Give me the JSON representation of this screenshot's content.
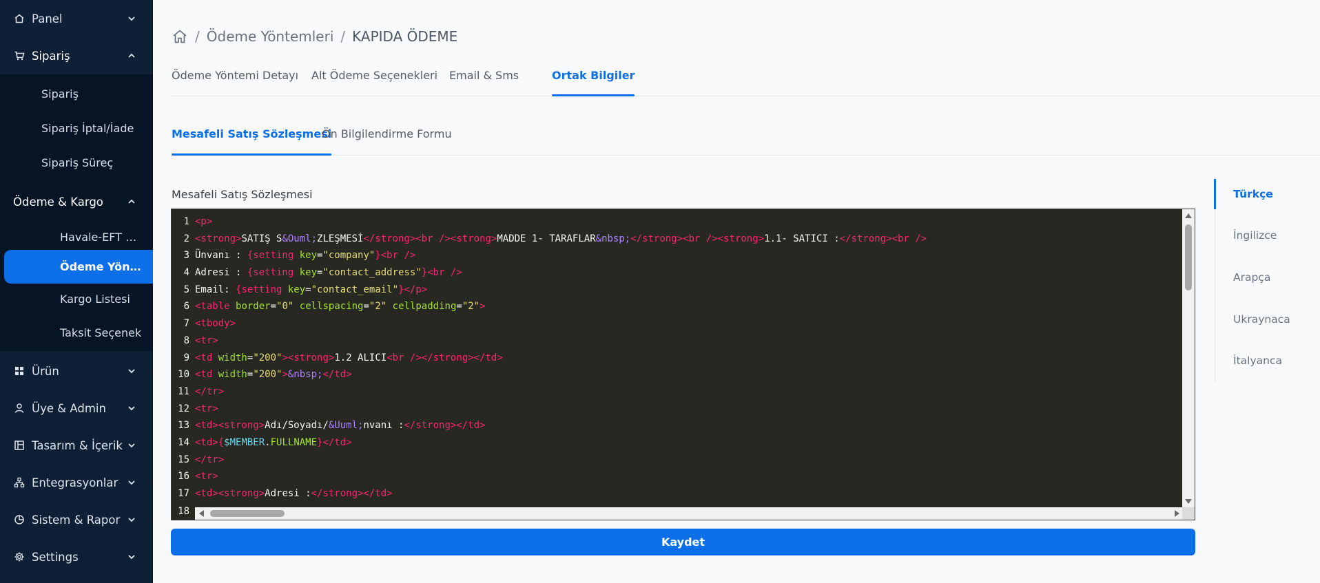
{
  "sidebar": {
    "items": [
      {
        "label": "Panel",
        "icon": "home-icon",
        "expanded": false
      },
      {
        "label": "Sipariş",
        "icon": "cart-icon",
        "expanded": true
      },
      {
        "label": "Ödeme & Kargo",
        "icon": "",
        "expanded": true
      },
      {
        "label": "Ürün",
        "icon": "grid-icon",
        "expanded": false
      },
      {
        "label": "Üye & Admin",
        "icon": "user-icon",
        "expanded": false
      },
      {
        "label": "Tasarım & İçerik",
        "icon": "layout-icon",
        "expanded": false
      },
      {
        "label": "Entegrasyonlar",
        "icon": "sitemap-icon",
        "expanded": false
      },
      {
        "label": "Sistem & Rapor",
        "icon": "pie-chart-icon",
        "expanded": false
      },
      {
        "label": "Settings",
        "icon": "gear-icon",
        "expanded": false
      }
    ],
    "siparis_sub": [
      "Sipariş",
      "Sipariş İptal/İade",
      "Sipariş Süreç"
    ],
    "odeme_sub": [
      "Havale-EFT Bil...",
      "Ödeme Yöntem",
      "Kargo Listesi",
      "Taksit Seçenek"
    ],
    "active_sub": "Ödeme Yöntem"
  },
  "breadcrumb": {
    "items": [
      "Ödeme Yöntemleri",
      "KAPIDA ÖDEME"
    ],
    "separator": "/"
  },
  "tabs": {
    "top": [
      "Ödeme Yöntemi Detayı",
      "Alt Ödeme Seçenekleri",
      "Email & Sms",
      "Ortak Bilgiler"
    ],
    "top_active": "Ortak Bilgiler",
    "inner": [
      "Mesafeli Satış Sözleşmesi",
      "Ön Bilgilendirme Formu"
    ],
    "inner_active": "Mesafeli Satış Sözleşmesi"
  },
  "editor": {
    "label": "Mesafeli Satış Sözleşmesi",
    "last_visible_line": "18",
    "lines": [
      {
        "n": "1",
        "tokens": [
          [
            "tag",
            "<p>"
          ]
        ]
      },
      {
        "n": "2",
        "tokens": [
          [
            "tag",
            "<strong>"
          ],
          [
            "txt",
            "SATIŞ S"
          ],
          [
            "ent",
            "&Ouml;"
          ],
          [
            "txt",
            "ZLEŞMESİ"
          ],
          [
            "tag",
            "</strong>"
          ],
          [
            "tag",
            "<br />"
          ],
          [
            "tag",
            "<strong>"
          ],
          [
            "txt",
            "MADDE 1- TARAFLAR"
          ],
          [
            "ent",
            "&nbsp;"
          ],
          [
            "tag",
            "</strong>"
          ],
          [
            "tag",
            "<br />"
          ],
          [
            "tag",
            "<strong>"
          ],
          [
            "txt",
            "1.1- SATICI :"
          ],
          [
            "tag",
            "</strong>"
          ],
          [
            "tag",
            "<br />"
          ]
        ]
      },
      {
        "n": "3",
        "tokens": [
          [
            "txt",
            "Ünvanı : "
          ],
          [
            "tag",
            "{setting "
          ],
          [
            "attr",
            "key"
          ],
          [
            "txt",
            "="
          ],
          [
            "str",
            "\"company\""
          ],
          [
            "tag",
            "}"
          ],
          [
            "tag",
            "<br />"
          ]
        ]
      },
      {
        "n": "4",
        "tokens": [
          [
            "txt",
            "Adresi : "
          ],
          [
            "tag",
            "{setting "
          ],
          [
            "attr",
            "key"
          ],
          [
            "txt",
            "="
          ],
          [
            "str",
            "\"contact_address\""
          ],
          [
            "tag",
            "}"
          ],
          [
            "tag",
            "<br />"
          ]
        ]
      },
      {
        "n": "5",
        "tokens": [
          [
            "txt",
            "Email: "
          ],
          [
            "tag",
            "{setting "
          ],
          [
            "attr",
            "key"
          ],
          [
            "txt",
            "="
          ],
          [
            "str",
            "\"contact_email\""
          ],
          [
            "tag",
            "}"
          ],
          [
            "tag",
            "</p>"
          ]
        ]
      },
      {
        "n": "6",
        "tokens": [
          [
            "tag",
            "<table "
          ],
          [
            "attr",
            "border"
          ],
          [
            "txt",
            "="
          ],
          [
            "str",
            "\"0\""
          ],
          [
            "txt",
            " "
          ],
          [
            "attr",
            "cellspacing"
          ],
          [
            "txt",
            "="
          ],
          [
            "str",
            "\"2\""
          ],
          [
            "txt",
            " "
          ],
          [
            "attr",
            "cellpadding"
          ],
          [
            "txt",
            "="
          ],
          [
            "str",
            "\"2\""
          ],
          [
            "tag",
            ">"
          ]
        ]
      },
      {
        "n": "7",
        "tokens": [
          [
            "tag",
            "<tbody>"
          ]
        ]
      },
      {
        "n": "8",
        "tokens": [
          [
            "tag",
            "<tr>"
          ]
        ]
      },
      {
        "n": "9",
        "tokens": [
          [
            "tag",
            "<td "
          ],
          [
            "attr",
            "width"
          ],
          [
            "txt",
            "="
          ],
          [
            "str",
            "\"200\""
          ],
          [
            "tag",
            ">"
          ],
          [
            "tag",
            "<strong>"
          ],
          [
            "txt",
            "1.2 ALICI"
          ],
          [
            "tag",
            "<br />"
          ],
          [
            "tag",
            "</strong>"
          ],
          [
            "tag",
            "</td>"
          ]
        ]
      },
      {
        "n": "10",
        "tokens": [
          [
            "tag",
            "<td "
          ],
          [
            "attr",
            "width"
          ],
          [
            "txt",
            "="
          ],
          [
            "str",
            "\"200\""
          ],
          [
            "tag",
            ">"
          ],
          [
            "ent",
            "&nbsp;"
          ],
          [
            "tag",
            "</td>"
          ]
        ]
      },
      {
        "n": "11",
        "tokens": [
          [
            "tag",
            "</tr>"
          ]
        ]
      },
      {
        "n": "12",
        "tokens": [
          [
            "tag",
            "<tr>"
          ]
        ]
      },
      {
        "n": "13",
        "tokens": [
          [
            "tag",
            "<td>"
          ],
          [
            "tag",
            "<strong>"
          ],
          [
            "txt",
            "Adı/Soyadı/"
          ],
          [
            "ent",
            "&Uuml;"
          ],
          [
            "txt",
            "nvanı :"
          ],
          [
            "tag",
            "</strong>"
          ],
          [
            "tag",
            "</td>"
          ]
        ]
      },
      {
        "n": "14",
        "tokens": [
          [
            "tag",
            "<td>"
          ],
          [
            "tag",
            "{"
          ],
          [
            "var",
            "$MEMBER"
          ],
          [
            "txt",
            "."
          ],
          [
            "attr",
            "FULLNAME"
          ],
          [
            "tag",
            "}"
          ],
          [
            "tag",
            "</td>"
          ]
        ]
      },
      {
        "n": "15",
        "tokens": [
          [
            "tag",
            "</tr>"
          ]
        ]
      },
      {
        "n": "16",
        "tokens": [
          [
            "tag",
            "<tr>"
          ]
        ]
      },
      {
        "n": "17",
        "tokens": [
          [
            "tag",
            "<td>"
          ],
          [
            "tag",
            "<strong>"
          ],
          [
            "txt",
            "Adresi :"
          ],
          [
            "tag",
            "</strong>"
          ],
          [
            "tag",
            "</td>"
          ]
        ]
      }
    ]
  },
  "save_button": "Kaydet",
  "languages": {
    "items": [
      "Türkçe",
      "İngilizce",
      "Arapça",
      "Ukraynaca",
      "İtalyanca"
    ],
    "active": "Türkçe"
  },
  "colors": {
    "sidebar_bg": "#0f1f36",
    "submenu_bg": "#071426",
    "accent": "#0d6fe8",
    "editor_bg": "#272822"
  }
}
